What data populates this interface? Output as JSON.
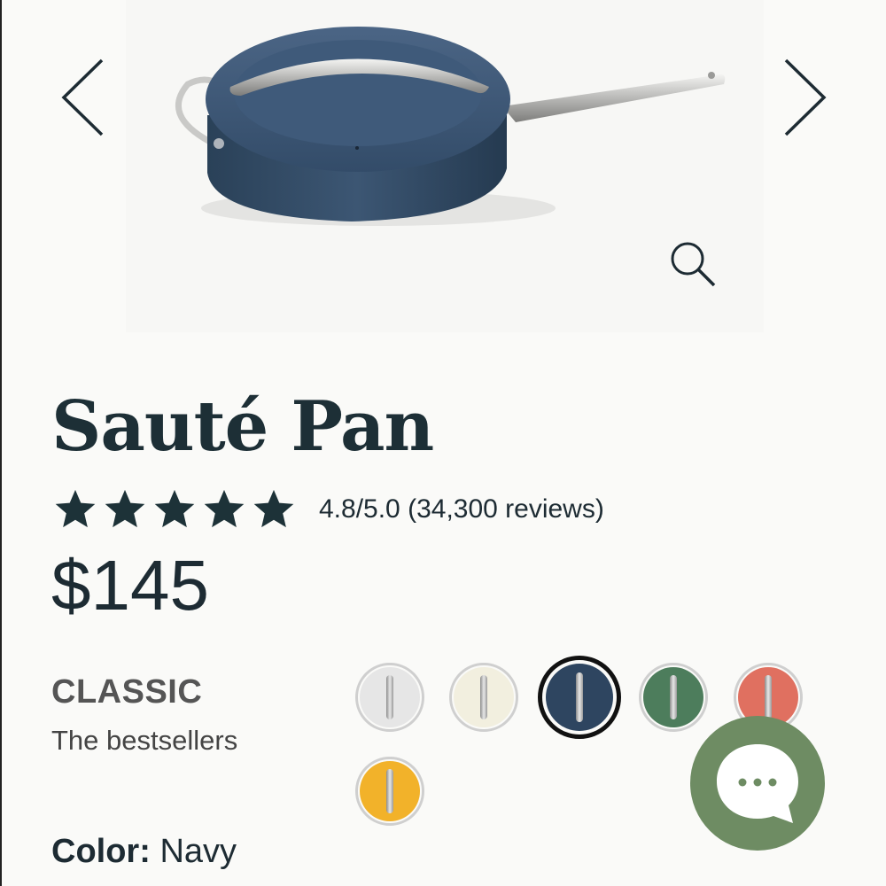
{
  "carousel": {
    "prev_icon": "chevron-left-icon",
    "next_icon": "chevron-right-icon",
    "zoom_icon": "search-icon",
    "image": "saute-pan-navy-with-lid"
  },
  "product": {
    "title": "Sauté Pan",
    "rating": {
      "stars": 5,
      "text": "4.8/5.0 (34,300 reviews)",
      "star_color": "#1d3238"
    },
    "price": "$145"
  },
  "collection": {
    "name": "CLASSIC",
    "subtitle": "The bestsellers"
  },
  "swatches": [
    {
      "color": "#e6e6e6",
      "selected": false
    },
    {
      "color": "#f2efdf",
      "selected": false
    },
    {
      "color": "#2e4560",
      "selected": true
    },
    {
      "color": "#4d7d5c",
      "selected": false
    },
    {
      "color": "#e07060",
      "selected": false
    },
    {
      "color": "#f2b22a",
      "selected": false
    }
  ],
  "color": {
    "label": "Color:",
    "value": "Navy"
  },
  "chat": {
    "icon": "chat-bubble-icon",
    "color": "#6e8c63"
  }
}
